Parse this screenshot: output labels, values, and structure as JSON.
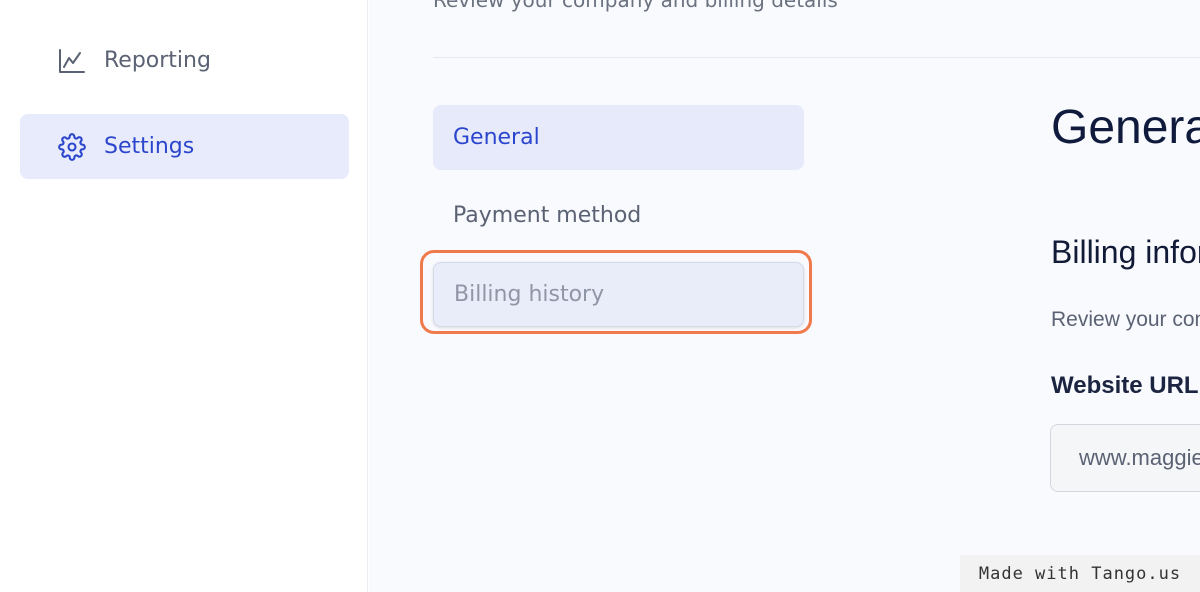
{
  "sidebar": {
    "items": [
      {
        "label": "Reporting",
        "icon": "chart-line-icon",
        "active": false
      },
      {
        "label": "Settings",
        "icon": "gear-icon",
        "active": true
      }
    ]
  },
  "main": {
    "subtitle": "Review your company and billing details",
    "tabs": [
      {
        "label": "General",
        "active": true
      },
      {
        "label": "Payment method",
        "active": false
      },
      {
        "label": "Billing history",
        "active": false,
        "highlighted": true
      }
    ],
    "content": {
      "title": "General",
      "section_title": "Billing information",
      "section_desc": "Review your company details",
      "website_label": "Website URL",
      "website_value": "www.maggie"
    }
  },
  "watermark": "Made with Tango.us",
  "colors": {
    "accent": "#2b46cc",
    "active_bg": "#e7ebfb",
    "highlight": "#f07a4b"
  }
}
